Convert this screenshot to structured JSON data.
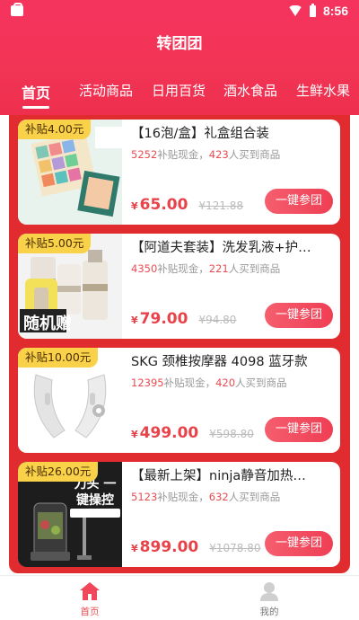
{
  "status_bar": {
    "time": "8:56"
  },
  "header": {
    "title": "转团团"
  },
  "tabs": [
    {
      "label": "首页"
    },
    {
      "label": "活动商品"
    },
    {
      "label": "日用百货"
    },
    {
      "label": "酒水食品"
    },
    {
      "label": "生鲜水果"
    }
  ],
  "products": [
    {
      "subsidy_tag": "补贴4.00元",
      "name": "【16泡/盒】礼盒组合装",
      "subsidy_cash": "5252",
      "subsidy_suffix": "补贴现金，",
      "buyers": "423",
      "buyers_suffix": "人买到商品",
      "currency": "¥",
      "price": "65.00",
      "original_price": "¥121.88",
      "button_label": "一键参团"
    },
    {
      "subsidy_tag": "补贴5.00元",
      "name": "【阿道夫套装】洗发乳液+护…",
      "subsidy_cash": "4350",
      "subsidy_suffix": "补贴现金，",
      "buyers": "221",
      "buyers_suffix": "人买到商品",
      "currency": "¥",
      "price": "79.00",
      "original_price": "¥94.80",
      "button_label": "一键参团",
      "image_overlay_text": "随机赠"
    },
    {
      "subsidy_tag": "补贴10.00元",
      "name": "SKG 颈椎按摩器 4098 蓝牙款",
      "subsidy_cash": "12395",
      "subsidy_suffix": "补贴现金，",
      "buyers": "420",
      "buyers_suffix": "人买到商品",
      "currency": "¥",
      "price": "499.00",
      "original_price": "¥598.80",
      "button_label": "一键参团"
    },
    {
      "subsidy_tag": "补贴26.00元",
      "name": "【最新上架】ninja静音加热…",
      "subsidy_cash": "5123",
      "subsidy_suffix": "补贴现金，",
      "buyers": "632",
      "buyers_suffix": "人买到商品",
      "currency": "¥",
      "price": "899.00",
      "original_price": "¥1078.80",
      "button_label": "一键参团",
      "image_overlay_text": "刀头 一键操控"
    }
  ],
  "bottom_nav": [
    {
      "label": "首页",
      "icon": "home-icon",
      "active": true
    },
    {
      "label": "我的",
      "icon": "user-icon",
      "active": false
    }
  ],
  "colors": {
    "brand": "#f23455",
    "list_bg": "#e02b2f",
    "price": "#e8434a",
    "tag": "#f9d24a"
  }
}
